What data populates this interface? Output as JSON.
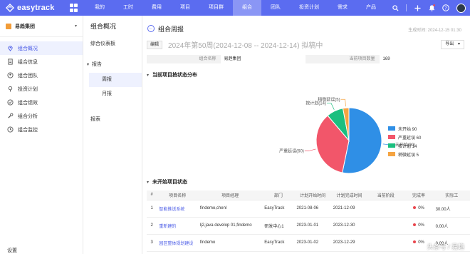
{
  "app": {
    "name": "easytrack"
  },
  "nav": [
    {
      "label": "我的",
      "active": false
    },
    {
      "label": "工时",
      "active": false
    },
    {
      "label": "费用",
      "active": false
    },
    {
      "label": "项目",
      "active": false
    },
    {
      "label": "项目群",
      "active": false
    },
    {
      "label": "组合",
      "active": true
    },
    {
      "label": "团队",
      "active": false
    },
    {
      "label": "投资计划",
      "active": false
    },
    {
      "label": "需求",
      "active": false
    },
    {
      "label": "产品",
      "active": false
    }
  ],
  "sidebar": {
    "group": "易趋集团",
    "items": [
      {
        "label": "组合概况",
        "icon": "location-icon",
        "active": true
      },
      {
        "label": "组合信息",
        "icon": "document-icon",
        "active": false
      },
      {
        "label": "组合团队",
        "icon": "user-icon",
        "active": false
      },
      {
        "label": "投资计划",
        "icon": "pin-icon",
        "active": false
      },
      {
        "label": "组合绩效",
        "icon": "performance-icon",
        "active": false
      },
      {
        "label": "组合分析",
        "icon": "wrench-icon",
        "active": false
      },
      {
        "label": "组合监控",
        "icon": "clock-icon",
        "active": false
      }
    ],
    "bottom_label": "设置"
  },
  "subbar": {
    "title": "组合概况",
    "dashboard": "综合仪表板",
    "section": "报告",
    "children": [
      {
        "label": "周报",
        "active": true
      },
      {
        "label": "月报",
        "active": false
      }
    ],
    "table_item": "报表"
  },
  "page": {
    "title": "组合周报",
    "generated": "生成时间: 2024-12-15 01:30",
    "edit_label": "编辑",
    "report_title": "2024年第50周(2024-12-08 -- 2024-12-14) 拟稿中",
    "export_label": "导出",
    "info": {
      "name_label": "组合名称",
      "name_value": "易趋集团",
      "count_label": "当前项目数量",
      "count_value": "169"
    },
    "section1": "当前项目按状态分布",
    "section2": "未开始项目状态"
  },
  "chart_data": {
    "type": "pie",
    "title": "当前项目按状态分布",
    "slices": [
      {
        "label": "未开始",
        "value": 90,
        "color": "#2f8fe6",
        "slice_label": "未开始(90)",
        "legend_label": "未开始 90"
      },
      {
        "label": "严重延误",
        "value": 60,
        "color": "#f2566a",
        "slice_label": "严重延误(60)",
        "legend_label": "严重延误 60"
      },
      {
        "label": "按计划",
        "value": 14,
        "color": "#1bbf7f",
        "slice_label": "按计划(14)",
        "legend_label": "按计划 14"
      },
      {
        "label": "稍微延误",
        "value": 5,
        "color": "#f5a442",
        "slice_label": "稍微延误(5)",
        "legend_label": "稍微延误 5"
      }
    ],
    "legend_position": "right"
  },
  "table": {
    "headers": [
      "#",
      "项目名称",
      "项目经理",
      "部门",
      "计划开始时间",
      "计划完成时间",
      "当前阶段",
      "完成率",
      "实际工"
    ],
    "rows": [
      {
        "num": "1",
        "name": "智能推送系统",
        "manager": "findemo,chenl",
        "dept": "EasyTrack",
        "start": "2021-08-06",
        "end": "2021-12-09",
        "stage": "",
        "rate": "0%",
        "actual": "30.00人"
      },
      {
        "num": "2",
        "name": "重新建的",
        "manager": "lj2,java develop 01,findemo",
        "dept": "研发中心1",
        "start": "2023-01-01",
        "end": "2023-12-30",
        "stage": "",
        "rate": "0%",
        "actual": "0.00人"
      },
      {
        "num": "3",
        "name": "园区整体规划建设",
        "manager": "findemo",
        "dept": "EasyTrack",
        "start": "2023-01-02",
        "end": "2023-12-29",
        "stage": "",
        "rate": "0%",
        "actual": "0.00人"
      }
    ]
  },
  "watermark": "头条号 / 易趋"
}
